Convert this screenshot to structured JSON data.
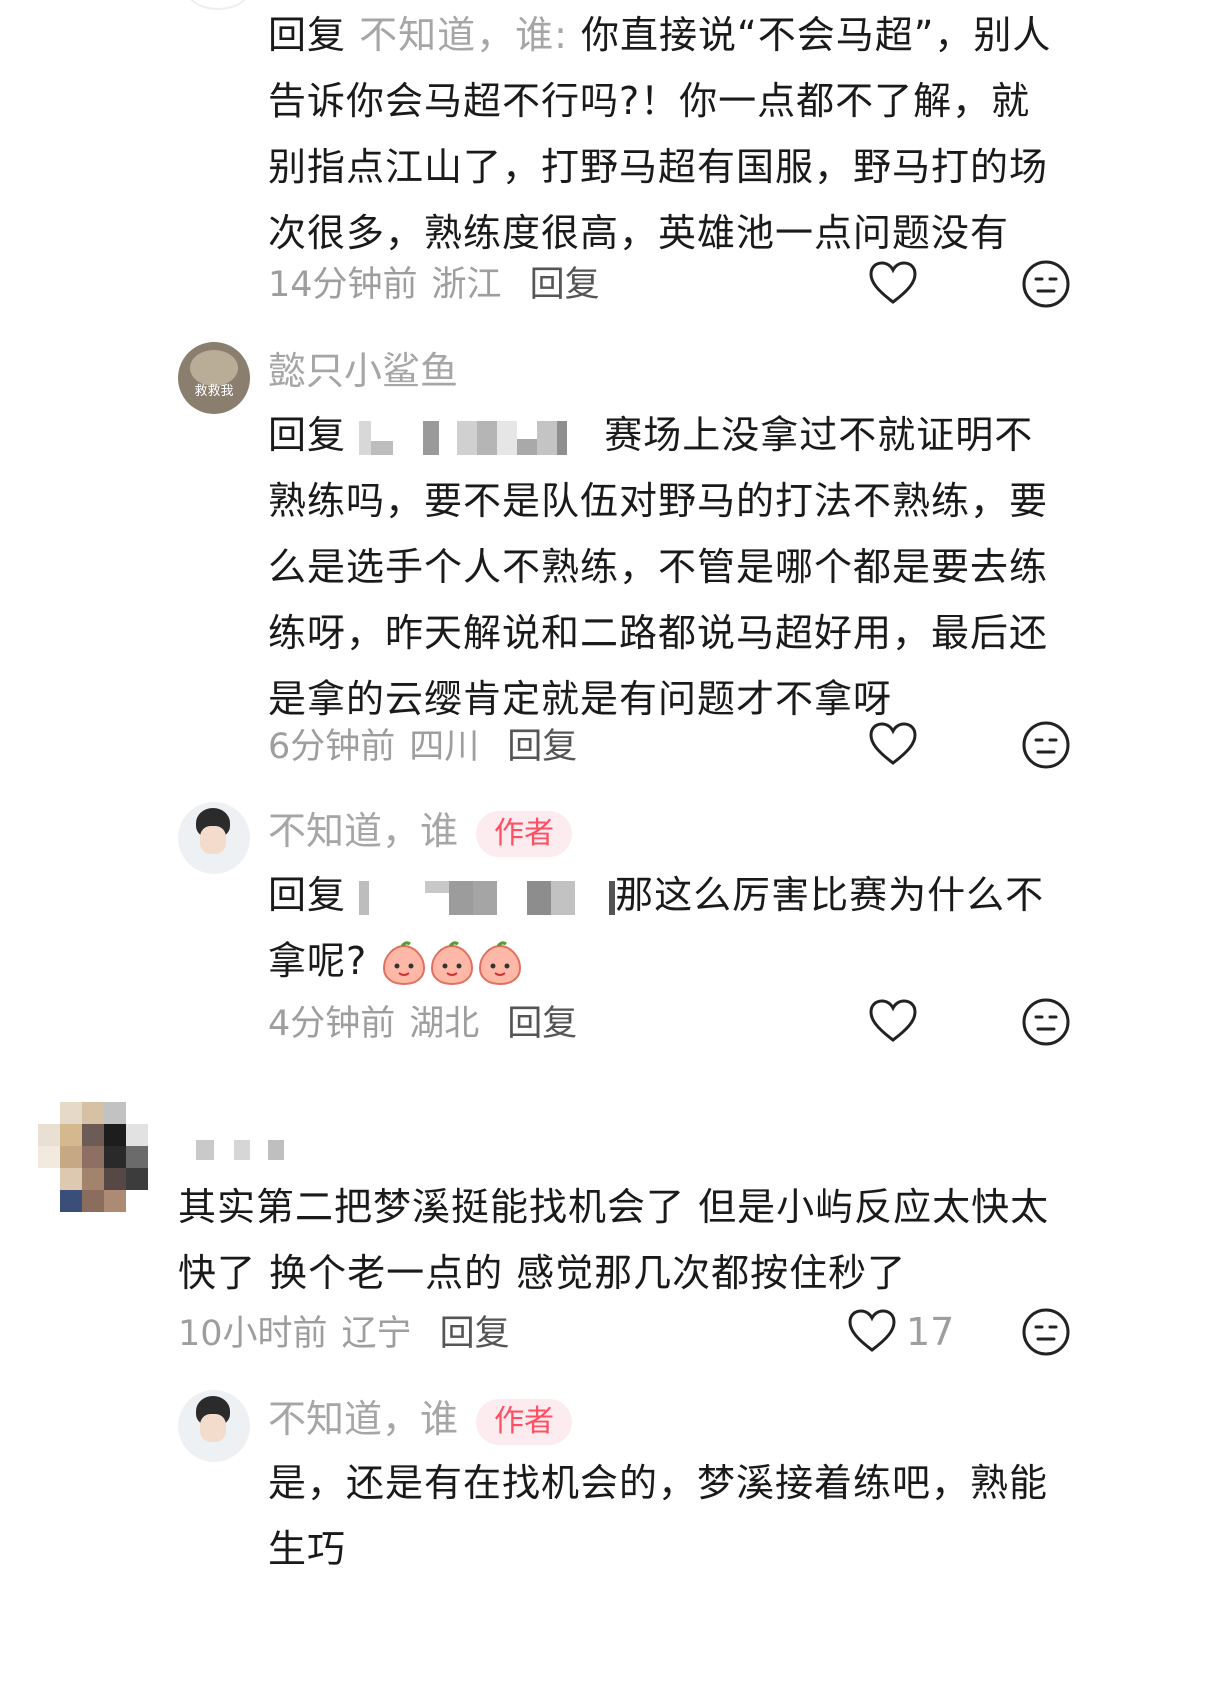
{
  "comments": [
    {
      "reply_prefix": "回复",
      "reply_target": "不知道，谁:",
      "text": " 你直接说“不会马超”，别人告诉你会马超不行吗?！你一点都不了解，就别指点江山了，打野马超有国服，野马打的场次很多，熟练度很高，英雄池一点问题没有",
      "time": "14分钟前",
      "location": "浙江",
      "reply_label": "回复"
    },
    {
      "author": "懿只小鲨鱼",
      "avatar_text": "救救我",
      "reply_prefix": "回复",
      "text": "赛场上没拿过不就证明不熟练吗，要不是队伍对野马的打法不熟练，要么是选手个人不熟练，不管是哪个都是要去练练呀，昨天解说和二路都说马超好用，最后还是拿的云缨肯定就是有问题才不拿呀",
      "time": "6分钟前",
      "location": "四川",
      "reply_label": "回复"
    },
    {
      "author": "不知道，谁",
      "badge": "作者",
      "reply_prefix": "回复",
      "text": "那这么厉害比赛为什么不拿呢?",
      "time": "4分钟前",
      "location": "湖北",
      "reply_label": "回复"
    },
    {
      "text": "其实第二把梦溪挺能找机会了 但是小屿反应太快太快了 换个老一点的 感觉那几次都按住秒了",
      "time": "10小时前",
      "location": "辽宁",
      "reply_label": "回复",
      "like_count": "17"
    },
    {
      "author": "不知道，谁",
      "badge": "作者",
      "text": "是，还是有在找机会的，梦溪接着练吧，熟能生巧"
    }
  ],
  "icons": {
    "like": "heart-outline-icon",
    "dislike": "neutral-face-icon"
  },
  "colors": {
    "badge_bg": "#fdecef",
    "badge_text": "#ff4f62",
    "meta": "#9e9e9e"
  }
}
